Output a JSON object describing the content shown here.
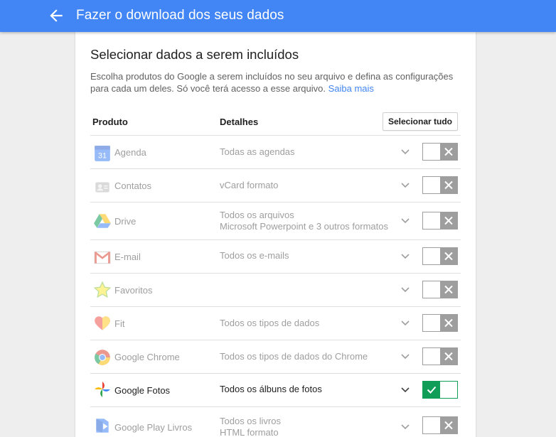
{
  "header": {
    "title": "Fazer o download dos seus dados",
    "back_icon": "arrow-back-icon"
  },
  "section": {
    "title": "Selecionar dados a serem incluídos",
    "description": "Escolha produtos do Google a serem incluídos no seu arquivo e defina as configurações para cada um deles. Só você terá acesso a esse arquivo.",
    "learn_more": "Saiba mais"
  },
  "table": {
    "col_product": "Produto",
    "col_details": "Detalhes",
    "select_all": "Selecionar tudo"
  },
  "colors": {
    "accent": "#4285f4",
    "enabled": "#0f9d58",
    "disabled_toggle": "#9e9e9e"
  },
  "products": [
    {
      "name": "Agenda",
      "icon": "calendar-icon",
      "details": [
        "Todas as agendas"
      ],
      "enabled": false
    },
    {
      "name": "Contatos",
      "icon": "contacts-icon",
      "details": [
        "vCard formato"
      ],
      "enabled": false
    },
    {
      "name": "Drive",
      "icon": "drive-icon",
      "details": [
        "Todos os arquivos",
        "Microsoft Powerpoint e 3 outros formatos"
      ],
      "enabled": false
    },
    {
      "name": "E-mail",
      "icon": "gmail-icon",
      "details": [
        "Todos os e-mails"
      ],
      "enabled": false
    },
    {
      "name": "Favoritos",
      "icon": "star-icon",
      "details": [],
      "enabled": false
    },
    {
      "name": "Fit",
      "icon": "heart-icon",
      "details": [
        "Todos os tipos de dados"
      ],
      "enabled": false
    },
    {
      "name": "Google Chrome",
      "icon": "chrome-icon",
      "details": [
        "Todos os tipos de dados do Chrome"
      ],
      "enabled": false
    },
    {
      "name": "Google Fotos",
      "icon": "photos-pinwheel-icon",
      "details": [
        "Todos os álbuns de fotos"
      ],
      "enabled": true
    },
    {
      "name": "Google Play Livros",
      "icon": "play-books-icon",
      "details": [
        "Todos os livros",
        "HTML formato"
      ],
      "enabled": false
    }
  ]
}
